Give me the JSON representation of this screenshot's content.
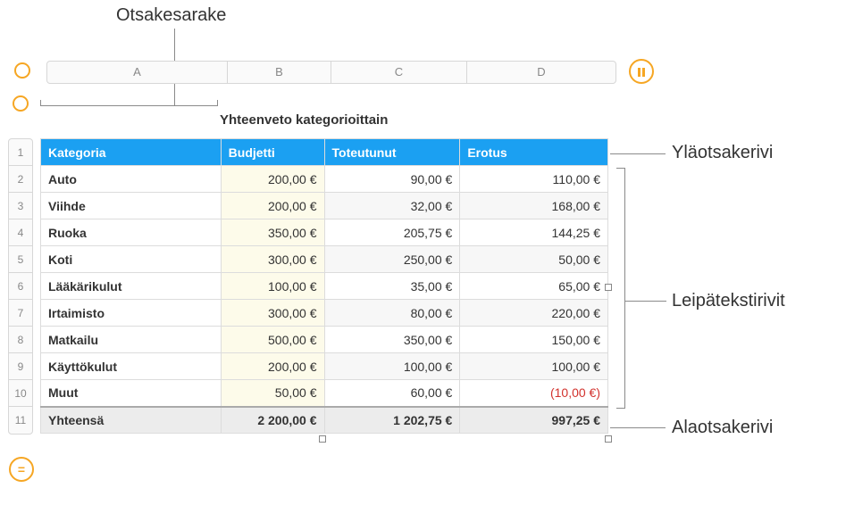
{
  "annotations": {
    "top": "Otsakesarake",
    "header_row": "Yläotsakerivi",
    "body_rows": "Leipätekstirivit",
    "footer_row": "Alaotsakerivi"
  },
  "column_letters": [
    "A",
    "B",
    "C",
    "D"
  ],
  "row_numbers": [
    "1",
    "2",
    "3",
    "4",
    "5",
    "6",
    "7",
    "8",
    "9",
    "10",
    "11"
  ],
  "title": "Yhteenveto kategorioittain",
  "headers": {
    "category": "Kategoria",
    "budget": "Budjetti",
    "actual": "Toteutunut",
    "diff": "Erotus"
  },
  "rows": [
    {
      "cat": "Auto",
      "budget": "200,00 €",
      "actual": "90,00 €",
      "diff": "110,00 €"
    },
    {
      "cat": "Viihde",
      "budget": "200,00 €",
      "actual": "32,00 €",
      "diff": "168,00 €"
    },
    {
      "cat": "Ruoka",
      "budget": "350,00 €",
      "actual": "205,75 €",
      "diff": "144,25 €"
    },
    {
      "cat": "Koti",
      "budget": "300,00 €",
      "actual": "250,00 €",
      "diff": "50,00 €"
    },
    {
      "cat": "Lääkärikulut",
      "budget": "100,00 €",
      "actual": "35,00 €",
      "diff": "65,00 €"
    },
    {
      "cat": "Irtaimisto",
      "budget": "300,00 €",
      "actual": "80,00 €",
      "diff": "220,00 €"
    },
    {
      "cat": "Matkailu",
      "budget": "500,00 €",
      "actual": "350,00 €",
      "diff": "150,00 €"
    },
    {
      "cat": "Käyttökulut",
      "budget": "200,00 €",
      "actual": "100,00 €",
      "diff": "100,00 €"
    },
    {
      "cat": "Muut",
      "budget": "50,00 €",
      "actual": "60,00 €",
      "diff": "(10,00 €)",
      "neg": true
    }
  ],
  "footer": {
    "label": "Yhteensä",
    "budget": "2 200,00 €",
    "actual": "1 202,75 €",
    "diff": "997,25 €"
  },
  "col_widths": {
    "A": 202,
    "B": 116,
    "C": 152,
    "D": 166
  },
  "icons": {
    "equals": "=",
    "pause": "pause-icon",
    "corner": "table-corner-icon"
  },
  "chart_data": {
    "type": "table",
    "title": "Yhteenveto kategorioittain",
    "columns": [
      "Kategoria",
      "Budjetti",
      "Toteutunut",
      "Erotus"
    ],
    "rows": [
      [
        "Auto",
        200.0,
        90.0,
        110.0
      ],
      [
        "Viihde",
        200.0,
        32.0,
        168.0
      ],
      [
        "Ruoka",
        350.0,
        205.75,
        144.25
      ],
      [
        "Koti",
        300.0,
        250.0,
        50.0
      ],
      [
        "Lääkärikulut",
        100.0,
        35.0,
        65.0
      ],
      [
        "Irtaimisto",
        300.0,
        80.0,
        220.0
      ],
      [
        "Matkailu",
        500.0,
        350.0,
        150.0
      ],
      [
        "Käyttökulut",
        200.0,
        100.0,
        100.0
      ],
      [
        "Muut",
        50.0,
        60.0,
        -10.0
      ]
    ],
    "footer": [
      "Yhteensä",
      2200.0,
      1202.75,
      997.25
    ],
    "currency": "€"
  }
}
